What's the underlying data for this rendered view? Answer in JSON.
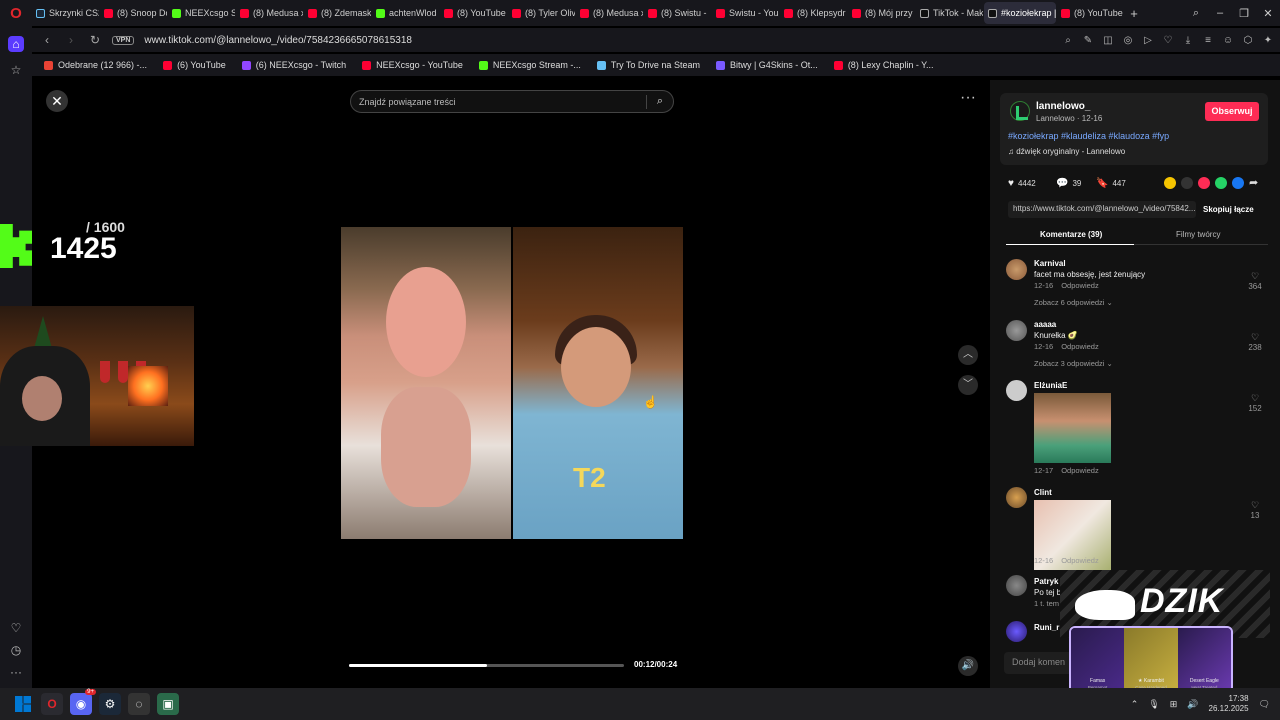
{
  "tabs": [
    {
      "label": "Skrzynki CS2",
      "fav": "ste"
    },
    {
      "label": "(8) Snoop Dogg",
      "fav": "yt"
    },
    {
      "label": "NEEXcsgo Stream",
      "fav": "kick"
    },
    {
      "label": "(8) Medusa x",
      "fav": "yt"
    },
    {
      "label": "(8) Zdemask",
      "fav": "yt"
    },
    {
      "label": "achtenWlod",
      "fav": "kick"
    },
    {
      "label": "(8) YouTube",
      "fav": "yt"
    },
    {
      "label": "(8) Tyler Oliv",
      "fav": "yt"
    },
    {
      "label": "(8) Medusa x",
      "fav": "yt"
    },
    {
      "label": "(8) Swistu -",
      "fav": "yt"
    },
    {
      "label": "Swistu - You",
      "fav": "yt"
    },
    {
      "label": "(8) Klepsydr",
      "fav": "yt"
    },
    {
      "label": "(8) Mój przy",
      "fav": "yt"
    },
    {
      "label": "TikTok - Mak",
      "fav": "tt"
    },
    {
      "label": "#koziołekrap | Ti",
      "fav": "tt",
      "active": true
    },
    {
      "label": "(8) YouTube",
      "fav": "yt"
    }
  ],
  "address": {
    "vpn_label": "VPN",
    "url": "www.tiktok.com/@lannelowo_/video/7584236665078615318"
  },
  "bookmarks": [
    {
      "label": "Odebrane (12 966) -...",
      "fav": "gm"
    },
    {
      "label": "(6) YouTube",
      "fav": "yt"
    },
    {
      "label": "(6) NEEXcsgo - Twitch",
      "fav": "tw"
    },
    {
      "label": "NEEXcsgo - YouTube",
      "fav": "yt"
    },
    {
      "label": "NEEXcsgo Stream -...",
      "fav": "kick"
    },
    {
      "label": "Try To Drive na Steam",
      "fav": "ste"
    },
    {
      "label": "Bitwy | G4Skins - Ot...",
      "fav": "g4"
    },
    {
      "label": "(8) Lexy Chaplin - Y...",
      "fav": "yt"
    }
  ],
  "player": {
    "search_placeholder": "Znajdź powiązane treści",
    "time": "00:12/00:24",
    "progress": 0.5,
    "shirt_text": "T2"
  },
  "overlay": {
    "counter_total": "/ 1600",
    "counter_value": "1425",
    "dzik": "DZIK",
    "skins": [
      {
        "name": "Famas",
        "sub": "Bergamot"
      },
      {
        "name": "★ Karambit",
        "sub": "Case Hardened"
      },
      {
        "name": "Desert Eagle",
        "sub": "Heat Treated"
      }
    ]
  },
  "post": {
    "author": "lannelowo_",
    "meta": "Lannelowo · 12-16",
    "follow": "Obserwuj",
    "tags": "#koziołekrap #klaudeliza #klaudoza #fyp",
    "sound": "dźwięk oryginalny - Lannelowo",
    "likes": "4442",
    "comments": "39",
    "saves": "447",
    "url": "https://www.tiktok.com/@lannelowo_/video/75842...",
    "copy": "Skopiuj łącze",
    "tab_comments": "Komentarze (39)",
    "tab_creator": "Filmy twórcy",
    "add_comment": "Dodaj komen"
  },
  "comments": [
    {
      "user": "Karnival",
      "text": "facet ma obsesję, jest żenujący",
      "date": "12-16",
      "reply": "Odpowiedz",
      "likes": "364",
      "more": "Zobacz 6 odpowiedzi ⌄"
    },
    {
      "user": "aaaaa",
      "text": "Knurełka 🥑",
      "date": "12-16",
      "reply": "Odpowiedz",
      "likes": "238",
      "more": "Zobacz 3 odpowiedzi ⌄"
    },
    {
      "user": "ElżuniaE",
      "text": "",
      "date": "12-17",
      "reply": "Odpowiedz",
      "likes": "152"
    },
    {
      "user": "Clint",
      "text": "",
      "date": "12-16",
      "reply": "Odpowiedz",
      "likes": "13"
    },
    {
      "user": "Patryk",
      "text": "Po tej b",
      "date": "1 t. tem"
    },
    {
      "user": "Runi_r"
    }
  ],
  "taskbar": {
    "time": "17:38",
    "date": "26.12.2025",
    "discord_badge": "9+"
  },
  "colors": {
    "accent": "#fe2c55",
    "tag": "#79a9ff",
    "opera": "#e0262c"
  }
}
